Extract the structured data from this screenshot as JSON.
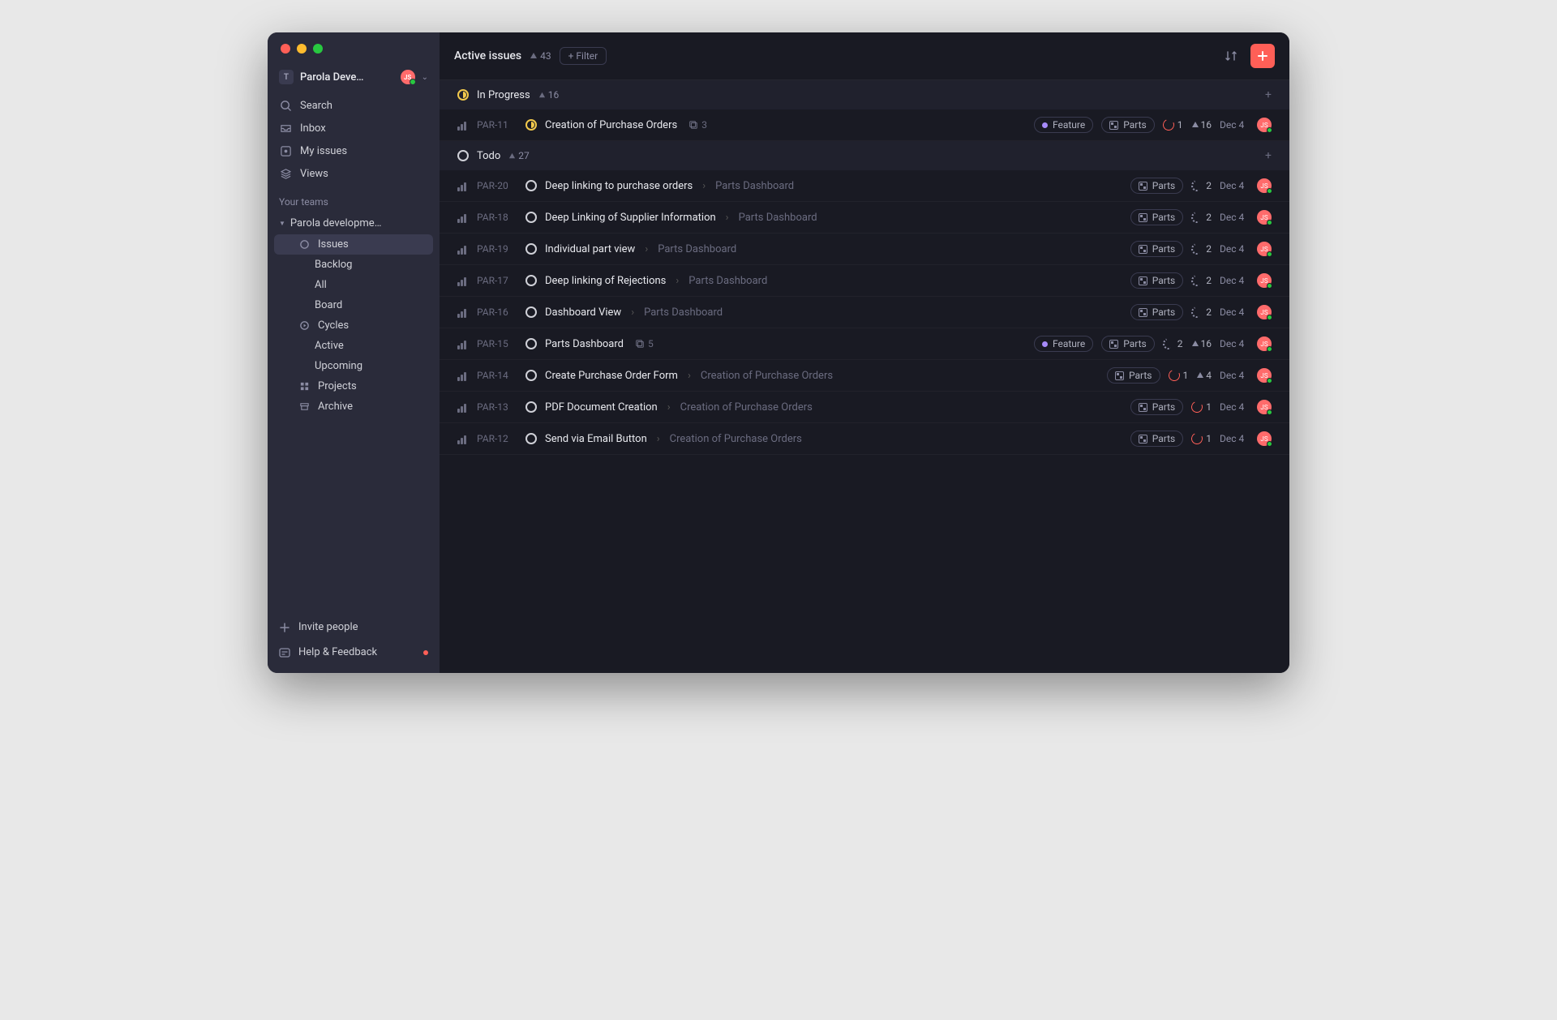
{
  "workspace": {
    "name": "Parola Deve…",
    "initials": "T",
    "user_initials": "JS"
  },
  "sidebar": {
    "nav": [
      {
        "label": "Search",
        "icon": "search"
      },
      {
        "label": "Inbox",
        "icon": "inbox"
      },
      {
        "label": "My issues",
        "icon": "target"
      },
      {
        "label": "Views",
        "icon": "stack"
      }
    ],
    "section_label": "Your teams",
    "team": {
      "name": "Parola developme…",
      "items": [
        {
          "label": "Issues",
          "icon": "circle",
          "active": true,
          "indent": 1
        },
        {
          "label": "Backlog",
          "indent": 2
        },
        {
          "label": "All",
          "indent": 2
        },
        {
          "label": "Board",
          "indent": 2
        },
        {
          "label": "Cycles",
          "icon": "cycle",
          "indent": 1
        },
        {
          "label": "Active",
          "indent": 2
        },
        {
          "label": "Upcoming",
          "indent": 2
        },
        {
          "label": "Projects",
          "icon": "grid",
          "indent": 1
        },
        {
          "label": "Archive",
          "icon": "archive",
          "indent": 1
        }
      ]
    },
    "invite": "Invite people",
    "help": "Help & Feedback"
  },
  "header": {
    "title": "Active issues",
    "count": 43,
    "filter_label": "+ Filter"
  },
  "groups": [
    {
      "status": "progress",
      "label": "In Progress",
      "count": 16
    },
    {
      "status": "todo",
      "label": "Todo",
      "count": 27
    }
  ],
  "issues": [
    {
      "group": 0,
      "id": "PAR-11",
      "status": "progress",
      "title": "Creation of Purchase Orders",
      "sub_count": 3,
      "feature": "Feature",
      "project": "Parts",
      "cycle": "1",
      "cycle_style": "red",
      "est": 16,
      "date": "Dec 4",
      "assignee": "JS"
    },
    {
      "group": 1,
      "id": "PAR-20",
      "status": "todo",
      "title": "Deep linking to purchase orders",
      "parent": "Parts Dashboard",
      "project": "Parts",
      "cycle": "2",
      "cycle_style": "dashed",
      "date": "Dec 4",
      "assignee": "JS"
    },
    {
      "group": 1,
      "id": "PAR-18",
      "status": "todo",
      "title": "Deep Linking of Supplier Information",
      "parent": "Parts Dashboard",
      "project": "Parts",
      "cycle": "2",
      "cycle_style": "dashed",
      "date": "Dec 4",
      "assignee": "JS"
    },
    {
      "group": 1,
      "id": "PAR-19",
      "status": "todo",
      "title": "Individual part view",
      "parent": "Parts Dashboard",
      "project": "Parts",
      "cycle": "2",
      "cycle_style": "dashed",
      "date": "Dec 4",
      "assignee": "JS"
    },
    {
      "group": 1,
      "id": "PAR-17",
      "status": "todo",
      "title": "Deep linking of Rejections",
      "parent": "Parts Dashboard",
      "project": "Parts",
      "cycle": "2",
      "cycle_style": "dashed",
      "date": "Dec 4",
      "assignee": "JS"
    },
    {
      "group": 1,
      "id": "PAR-16",
      "status": "todo",
      "title": "Dashboard View",
      "parent": "Parts Dashboard",
      "project": "Parts",
      "cycle": "2",
      "cycle_style": "dashed",
      "date": "Dec 4",
      "assignee": "JS"
    },
    {
      "group": 1,
      "id": "PAR-15",
      "status": "todo",
      "title": "Parts Dashboard",
      "sub_count": 5,
      "feature": "Feature",
      "project": "Parts",
      "cycle": "2",
      "cycle_style": "dashed",
      "est": 16,
      "date": "Dec 4",
      "assignee": "JS"
    },
    {
      "group": 1,
      "id": "PAR-14",
      "status": "todo",
      "title": "Create Purchase Order Form",
      "parent": "Creation of Purchase Orders",
      "project": "Parts",
      "cycle": "1",
      "cycle_style": "red",
      "est": 4,
      "date": "Dec 4",
      "assignee": "JS"
    },
    {
      "group": 1,
      "id": "PAR-13",
      "status": "todo",
      "title": "PDF Document Creation",
      "parent": "Creation of Purchase Orders",
      "project": "Parts",
      "cycle": "1",
      "cycle_style": "red",
      "date": "Dec 4",
      "assignee": "JS"
    },
    {
      "group": 1,
      "id": "PAR-12",
      "status": "todo",
      "title": "Send via Email Button",
      "parent": "Creation of Purchase Orders",
      "project": "Parts",
      "cycle": "1",
      "cycle_style": "red",
      "date": "Dec 4",
      "assignee": "JS"
    }
  ]
}
